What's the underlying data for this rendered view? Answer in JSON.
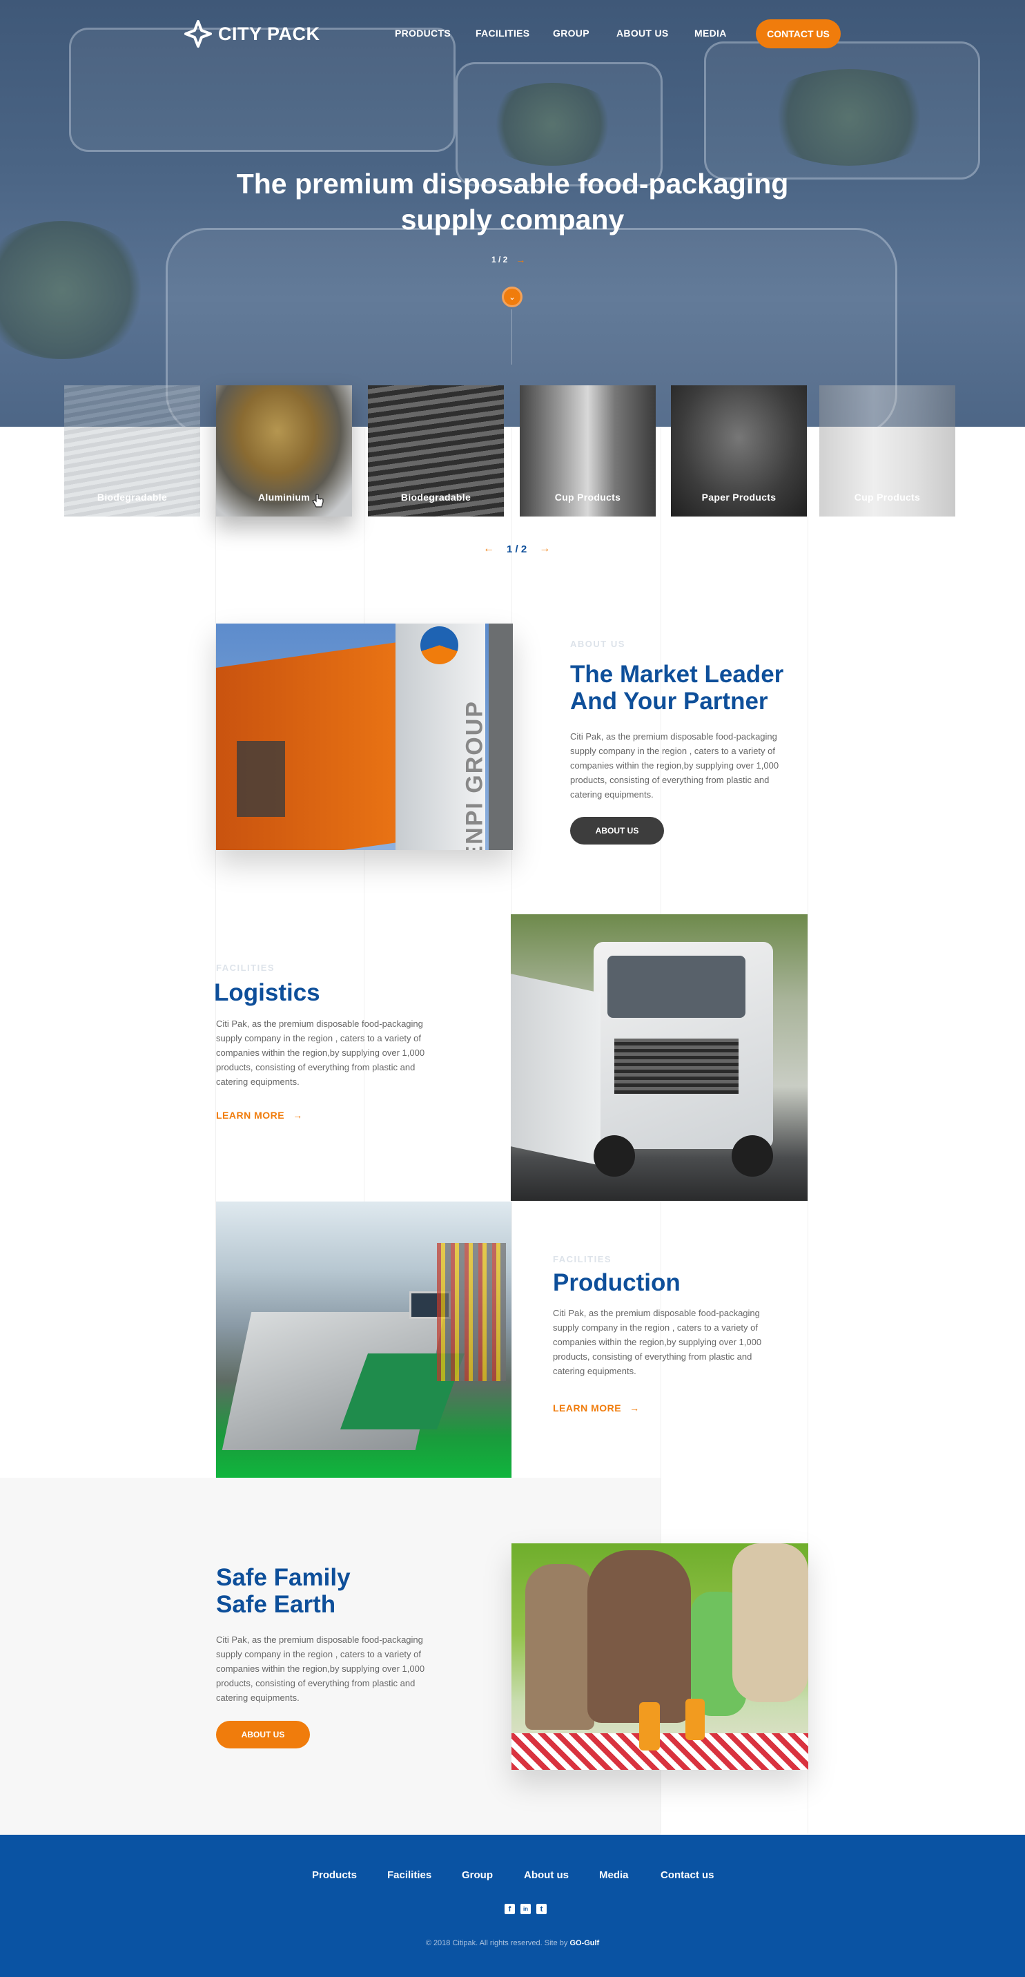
{
  "nav": {
    "logo_text": "CITY PACK",
    "links": [
      "PRODUCTS",
      "FACILITIES",
      "GROUP",
      "ABOUT US",
      "MEDIA"
    ],
    "contact": "CONTACT US"
  },
  "hero": {
    "title": "The premium disposable food-packaging supply company",
    "pager": "1 / 2",
    "arrow_next": "→"
  },
  "products": {
    "cards": [
      "Biodegradable",
      "Aluminium",
      "Biodegradable",
      "Cup Products",
      "Paper Products",
      "Cup Products"
    ],
    "pager": "1 / 2",
    "prev": "←",
    "next": "→"
  },
  "about": {
    "eyebrow": "ABOUT US",
    "title_line1": "The Market Leader",
    "title_line2": "And Your Partner",
    "text": "Citi Pak, as the premium disposable food-packaging supply company in the region , caters to a variety of companies within the region,by supplying over 1,000 products, consisting of everything from plastic and catering equipments.",
    "button": "ABOUT US",
    "sign_text": "ENPI GROUP"
  },
  "logistics": {
    "eyebrow": "FACILITIES",
    "title": "Logistics",
    "text": "Citi Pak, as the premium disposable food-packaging supply company in the region , caters to a variety of companies within the region,by supplying over 1,000 products, consisting of everything from plastic and catering equipments.",
    "link": "LEARN MORE"
  },
  "production": {
    "eyebrow": "FACILITIES",
    "title": "Production",
    "text": "Citi Pak, as the premium disposable food-packaging supply company in the region , caters to a variety of companies within the region,by supplying over 1,000 products, consisting of everything from plastic and catering equipments.",
    "link": "LEARN MORE"
  },
  "safe": {
    "title_line1": "Safe Family",
    "title_line2": "Safe Earth",
    "text": "Citi Pak, as the premium disposable food-packaging supply company in the region , caters to a variety of companies within the region,by supplying over 1,000 products, consisting of everything from plastic and catering equipments.",
    "button": "ABOUT US"
  },
  "footer": {
    "links": [
      "Products",
      "Facilities",
      "Group",
      "About us",
      "Media",
      "Contact us"
    ],
    "social": [
      "f",
      "in",
      "t"
    ],
    "copy_text": "© 2018 Citipak. All rights reserved. Site by",
    "copy_brand": "GO-Gulf"
  },
  "colors": {
    "accent": "#f07c0c",
    "brand_blue": "#0e4f9a",
    "footer_blue": "#0a53a3"
  }
}
